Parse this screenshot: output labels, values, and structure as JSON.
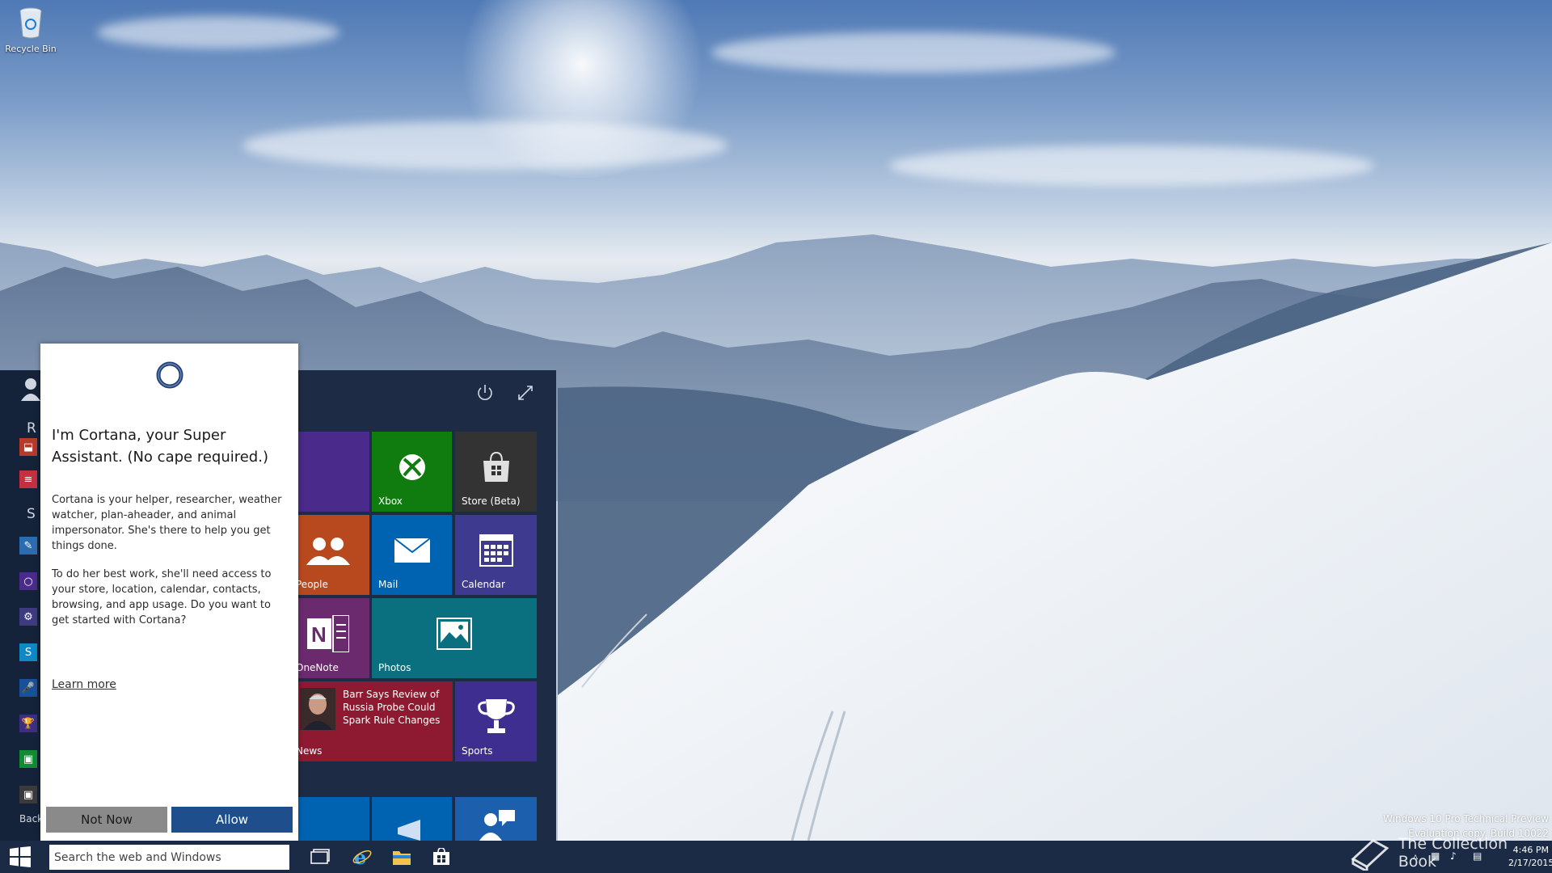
{
  "desktop": {
    "recycle_bin_label": "Recycle Bin",
    "watermark_line1": "Windows 10 Pro Technical Preview",
    "watermark_line2": "Evaluation copy. Build 10022",
    "brand_text": "The Collection Book"
  },
  "start_menu": {
    "left_column": {
      "letters": [
        "R",
        "S"
      ],
      "back_label": "Back",
      "icons": [
        "app-icon",
        "app-icon",
        "paint-icon",
        "circle-icon",
        "gear-icon",
        "skype-icon",
        "mic-icon",
        "trophy-icon",
        "store-icon",
        "store-icon"
      ]
    },
    "tiles": [
      {
        "label": "Xbox",
        "color": "#107c10",
        "icon": "xbox-icon"
      },
      {
        "label": "Store (Beta)",
        "color": "#333333",
        "icon": "store-icon"
      },
      {
        "label": "People",
        "color": "#b8491f",
        "icon": "people-icon"
      },
      {
        "label": "Mail",
        "color": "#0063b1",
        "icon": "mail-icon"
      },
      {
        "label": "Calendar",
        "color": "#3e3a8f",
        "icon": "calendar-icon"
      },
      {
        "label": "OneNote",
        "color": "#6b2a6e",
        "icon": "onenote-icon"
      },
      {
        "label": "Photos",
        "color": "#0a7080",
        "icon": "photos-icon"
      },
      {
        "label": "News",
        "color": "#8d1a30",
        "headline": "Barr Says Review of Russia Probe Could Spark Rule Changes"
      },
      {
        "label": "Sports",
        "color": "#3e2e8f",
        "icon": "trophy-icon"
      }
    ]
  },
  "cortana": {
    "headline": "I'm Cortana, your Super Assistant. (No cape required.)",
    "paragraph1": "Cortana is your helper, researcher, weather watcher, plan-aheader, and animal impersonator. She's there to help you get things done.",
    "paragraph2": "To do her best work, she'll need access to your store, location, calendar, contacts, browsing, and app usage. Do you want to get started with Cortana?",
    "learn_more": "Learn more",
    "not_now_label": "Not Now",
    "allow_label": "Allow"
  },
  "taskbar": {
    "search_placeholder": "Search the web and Windows",
    "time": "4:46 PM",
    "date": "2/17/2015"
  },
  "colors": {
    "taskbar": "#1b2b45",
    "start_bg": "#1d2c44",
    "allow_button": "#1f4e8c",
    "not_now_button": "#8a8a8a"
  }
}
